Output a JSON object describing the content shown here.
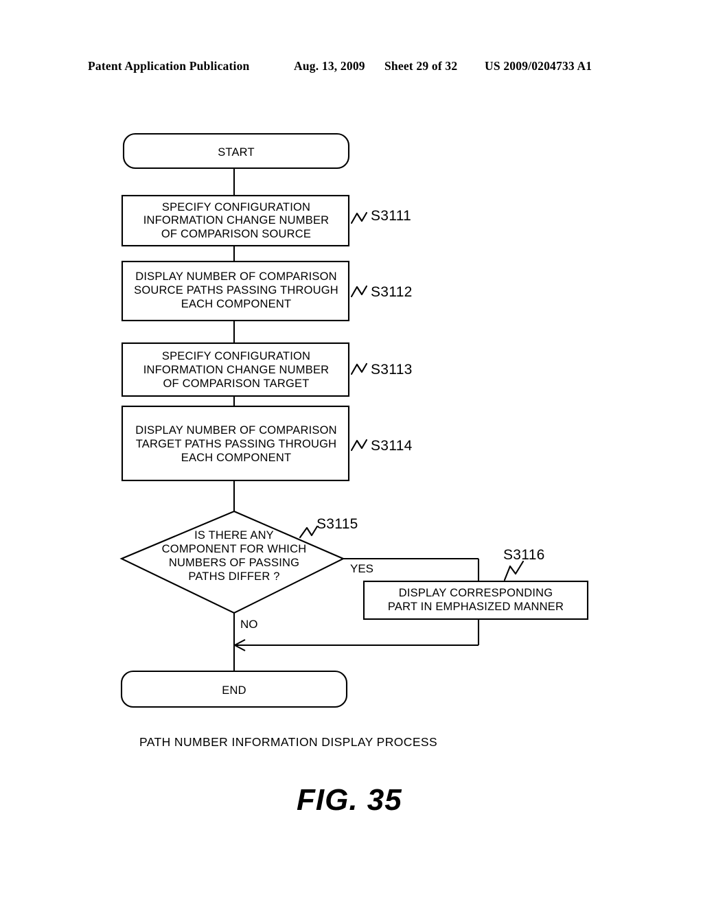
{
  "header": {
    "publication": "Patent Application Publication",
    "date": "Aug. 13, 2009",
    "sheet": "Sheet 29 of 32",
    "document_number": "US 2009/0204733 A1"
  },
  "figure": {
    "label": "FIG. 35",
    "caption": "PATH NUMBER INFORMATION DISPLAY PROCESS",
    "nodes": {
      "start": {
        "text": "START"
      },
      "end": {
        "text": "END"
      },
      "s3111": {
        "step": "S3111",
        "line1": "SPECIFY CONFIGURATION",
        "line2": "INFORMATION CHANGE NUMBER",
        "line3": "OF COMPARISON SOURCE"
      },
      "s3112": {
        "step": "S3112",
        "line1": "DISPLAY NUMBER OF COMPARISON",
        "line2": "SOURCE PATHS PASSING THROUGH",
        "line3": "EACH COMPONENT"
      },
      "s3113": {
        "step": "S3113",
        "line1": "SPECIFY CONFIGURATION",
        "line2": "INFORMATION CHANGE NUMBER",
        "line3": "OF COMPARISON TARGET"
      },
      "s3114": {
        "step": "S3114",
        "line1": "DISPLAY NUMBER OF COMPARISON",
        "line2": "TARGET PATHS PASSING THROUGH",
        "line3": "EACH COMPONENT"
      },
      "s3115": {
        "step": "S3115",
        "line1": "IS THERE ANY",
        "line2": "COMPONENT FOR WHICH",
        "line3": "NUMBERS OF PASSING",
        "line4": "PATHS DIFFER ?"
      },
      "s3116": {
        "step": "S3116",
        "line1": "DISPLAY CORRESPONDING",
        "line2": "PART IN EMPHASIZED MANNER"
      }
    },
    "branches": {
      "yes": "YES",
      "no": "NO"
    }
  },
  "colors": {
    "ink": "#000000",
    "paper": "#ffffff"
  }
}
